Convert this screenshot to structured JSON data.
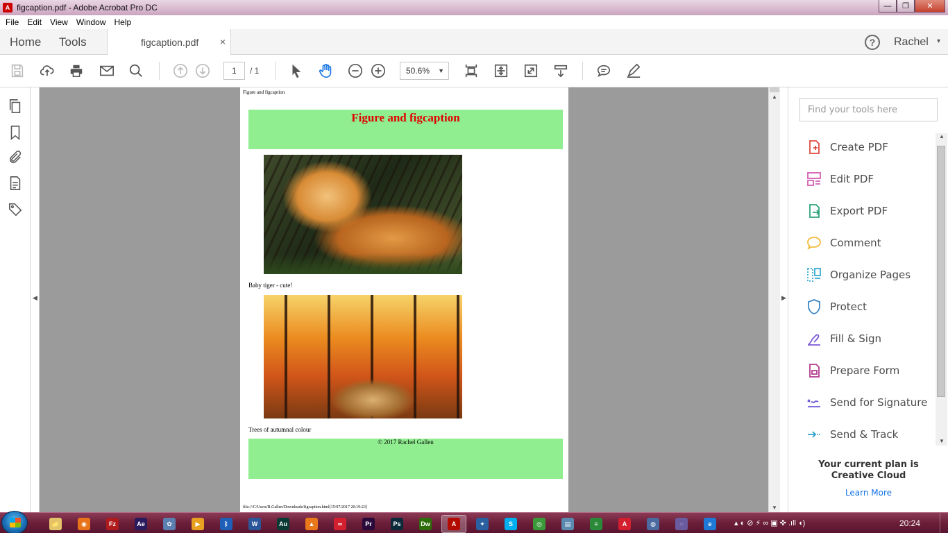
{
  "window": {
    "title": "figcaption.pdf - Adobe Acrobat Pro DC",
    "min": "—",
    "max": "❐",
    "close": "✕"
  },
  "menu": [
    "File",
    "Edit",
    "View",
    "Window",
    "Help"
  ],
  "tabs": {
    "home": "Home",
    "tools": "Tools",
    "document": "figcaption.pdf",
    "close": "×"
  },
  "user": {
    "help": "?",
    "name": "Rachel",
    "caret": "▾"
  },
  "toolbar": {
    "page_current": "1",
    "page_total": "/ 1",
    "zoom": "50.6%",
    "zoom_caret": "▼"
  },
  "document": {
    "header": "Figure and figcaption",
    "heading": "Figure and figcaption",
    "caption1": "Baby tiger - cute!",
    "caption2": "Trees of autumnal colour",
    "footer": "© 2017 Rachel Gallen",
    "print_footer": "file:///C/Users/R.Gallen/Downloads/figcaption.html[15/07/2017 20:19:23]",
    "box_color": "#90ee90",
    "heading_color": "#e00000"
  },
  "tools_pane": {
    "search_placeholder": "Find your tools here",
    "items": [
      {
        "label": "Create PDF",
        "icon": "create-pdf-icon",
        "color": "#e04a3f"
      },
      {
        "label": "Edit PDF",
        "icon": "edit-pdf-icon",
        "color": "#d45fb3"
      },
      {
        "label": "Export PDF",
        "icon": "export-pdf-icon",
        "color": "#2ea37a"
      },
      {
        "label": "Comment",
        "icon": "comment-icon",
        "color": "#f2b93b"
      },
      {
        "label": "Organize Pages",
        "icon": "organize-pages-icon",
        "color": "#38a9d6"
      },
      {
        "label": "Protect",
        "icon": "protect-icon",
        "color": "#3a86c8"
      },
      {
        "label": "Fill & Sign",
        "icon": "fill-sign-icon",
        "color": "#7a5ad8"
      },
      {
        "label": "Prepare Form",
        "icon": "prepare-form-icon",
        "color": "#b23a8e"
      },
      {
        "label": "Send for Signature",
        "icon": "send-signature-icon",
        "color": "#6b5ad6"
      },
      {
        "label": "Send & Track",
        "icon": "send-track-icon",
        "color": "#2a9fc9"
      }
    ],
    "plan": "Your current plan is Creative Cloud",
    "learn_more": "Learn More"
  },
  "taskbar": {
    "apps": [
      {
        "name": "explorer",
        "glyph": "📁",
        "color": "#e3c46a"
      },
      {
        "name": "firefox",
        "glyph": "◉",
        "color": "#e8731a"
      },
      {
        "name": "filezilla",
        "glyph": "Fz",
        "color": "#b01c1c"
      },
      {
        "name": "after-effects",
        "glyph": "Ae",
        "color": "#2a1a5e"
      },
      {
        "name": "paint",
        "glyph": "✿",
        "color": "#5a7fb0"
      },
      {
        "name": "media-player",
        "glyph": "▶",
        "color": "#e8a020"
      },
      {
        "name": "bluetooth",
        "glyph": "ᛒ",
        "color": "#1e5fb8"
      },
      {
        "name": "word",
        "glyph": "W",
        "color": "#2b579a"
      },
      {
        "name": "audition",
        "glyph": "Au",
        "color": "#0a3a34"
      },
      {
        "name": "vlc",
        "glyph": "▲",
        "color": "#e8781a"
      },
      {
        "name": "creative-cloud",
        "glyph": "∞",
        "color": "#d2202f"
      },
      {
        "name": "premiere",
        "glyph": "Pr",
        "color": "#2a0a3a"
      },
      {
        "name": "photoshop",
        "glyph": "Ps",
        "color": "#0a2a3a"
      },
      {
        "name": "dreamweaver",
        "glyph": "Dw",
        "color": "#2e6e0a"
      },
      {
        "name": "acrobat",
        "glyph": "A",
        "color": "#b30b00"
      },
      {
        "name": "tool",
        "glyph": "✦",
        "color": "#2a5fa0"
      },
      {
        "name": "skype",
        "glyph": "S",
        "color": "#00aff0"
      },
      {
        "name": "chrome",
        "glyph": "◎",
        "color": "#3a9a3a"
      },
      {
        "name": "notes",
        "glyph": "▤",
        "color": "#5a8ab0"
      },
      {
        "name": "sheets",
        "glyph": "≡",
        "color": "#2a8a3a"
      },
      {
        "name": "acrobat-reader",
        "glyph": "A",
        "color": "#d2202f"
      },
      {
        "name": "network",
        "glyph": "◍",
        "color": "#4a6aa0"
      },
      {
        "name": "browser",
        "glyph": "◌",
        "color": "#6a5aa0"
      },
      {
        "name": "ie",
        "glyph": "e",
        "color": "#1e7ad6"
      }
    ],
    "tray": "▴  ◐  ⊘  ⚡  ∞  ▣  ✜  .ıll  ◖)",
    "clock": "20:24"
  }
}
